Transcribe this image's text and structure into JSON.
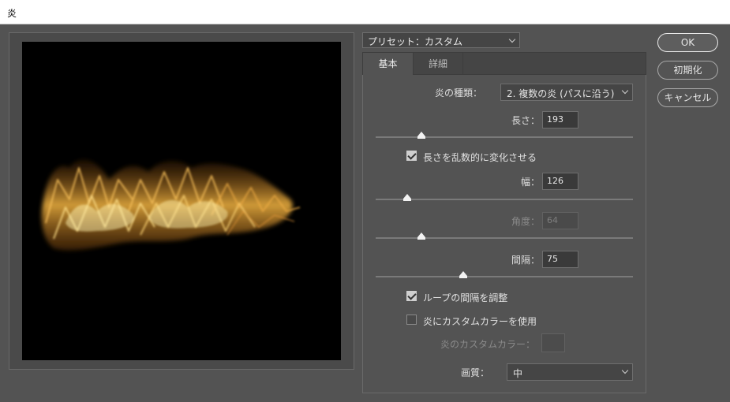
{
  "window": {
    "title": "炎"
  },
  "preset": {
    "label": "プリセット：カスタム"
  },
  "tabs": [
    {
      "label": "基本"
    },
    {
      "label": "詳細"
    }
  ],
  "controls": {
    "flame_type": {
      "label": "炎の種類：",
      "value": "2. 複数の炎 (パスに沿う)"
    },
    "length": {
      "label": "長さ：",
      "value": "193"
    },
    "randomize_length": {
      "label": "長さを乱数的に変化させる",
      "checked": true
    },
    "width": {
      "label": "幅：",
      "value": "126"
    },
    "angle": {
      "label": "角度：",
      "value": "64"
    },
    "interval": {
      "label": "間隔：",
      "value": "75"
    },
    "adjust_loop": {
      "label": "ループの間隔を調整",
      "checked": true
    },
    "custom_color_enable": {
      "label": "炎にカスタムカラーを使用",
      "checked": false
    },
    "custom_color": {
      "label": "炎のカスタムカラー："
    },
    "quality": {
      "label": "画質：",
      "value": "中"
    }
  },
  "buttons": {
    "ok": "OK",
    "reset": "初期化",
    "cancel": "キャンセル"
  },
  "colors": {
    "flame_core": "#fff3b0",
    "flame_mid": "#f5b642",
    "flame_edge": "#8a4a10"
  }
}
